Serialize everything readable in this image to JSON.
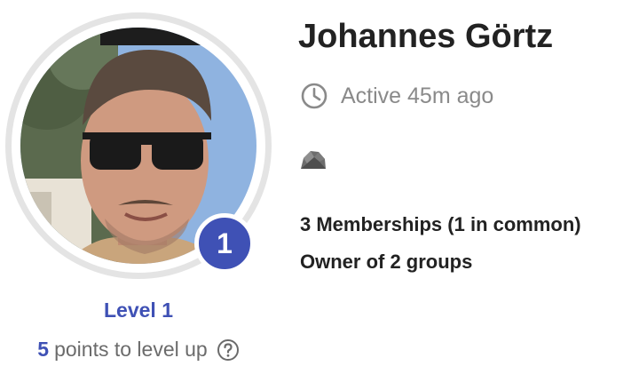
{
  "profile": {
    "name": "Johannes Görtz",
    "activity": "Active 45m ago",
    "level_badge": "1",
    "level_label": "Level 1",
    "points_value": "5",
    "points_suffix": "points to level up",
    "memberships": "3 Memberships (1 in common)",
    "owner_of": "Owner of 2 groups"
  },
  "icons": {
    "clock": "clock-icon",
    "help": "help-circle-icon",
    "badge": "rock-badge-icon"
  },
  "colors": {
    "accent": "#3f51b5",
    "muted_text": "#8a8a8a",
    "ring": "#e4e4e4"
  }
}
